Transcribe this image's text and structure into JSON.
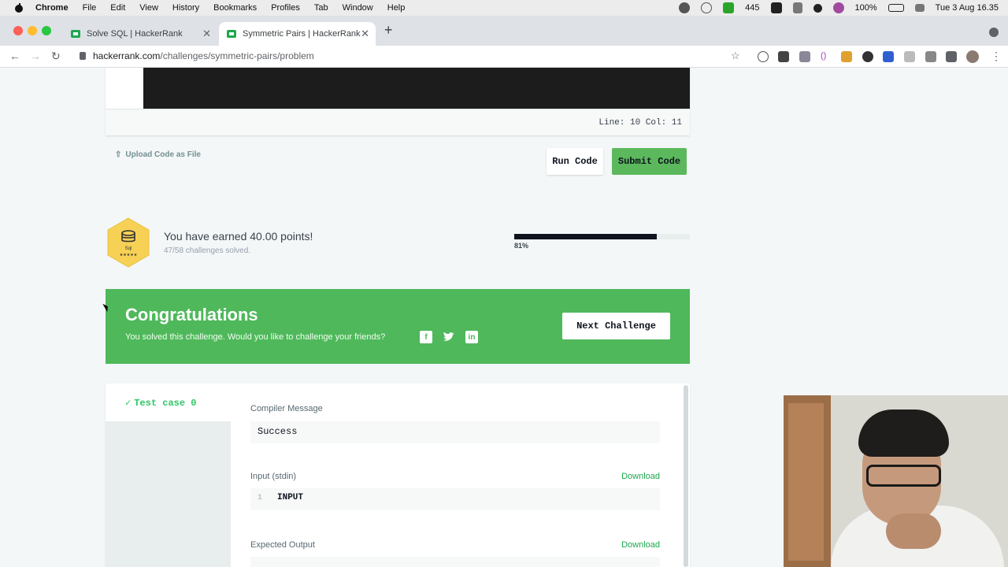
{
  "menubar": {
    "app": "Chrome",
    "items": [
      "File",
      "Edit",
      "View",
      "History",
      "Bookmarks",
      "Profiles",
      "Tab",
      "Window",
      "Help"
    ],
    "status_count": "445",
    "battery": "100%",
    "datetime": "Tue 3 Aug  16.35"
  },
  "tabs": [
    {
      "title": "Solve SQL | HackerRank",
      "active": false
    },
    {
      "title": "Symmetric Pairs | HackerRank",
      "active": true
    }
  ],
  "address": {
    "domain": "hackerrank.com",
    "path": "/challenges/symmetric-pairs/problem"
  },
  "editor": {
    "status": "Line: 10 Col: 11"
  },
  "actions": {
    "upload": "Upload Code as File",
    "run": "Run Code",
    "submit": "Submit Code"
  },
  "progress": {
    "badge_label": "Sql",
    "earned": "You have earned 40.00 points!",
    "solved": "47/58 challenges solved.",
    "percent_label": "81%",
    "percent": 0.81
  },
  "congrats": {
    "title": "Congratulations",
    "message": "You solved this challenge. Would you like to challenge your friends?",
    "next": "Next Challenge"
  },
  "results": {
    "testcase": "Test case 0",
    "compiler_label": "Compiler Message",
    "compiler_value": "Success",
    "input_label": "Input (stdin)",
    "input_line": "1",
    "input_value": "INPUT",
    "expected_label": "Expected Output",
    "download": "Download"
  },
  "colors": {
    "green": "#4fb85b",
    "dark": "#0e141e"
  }
}
